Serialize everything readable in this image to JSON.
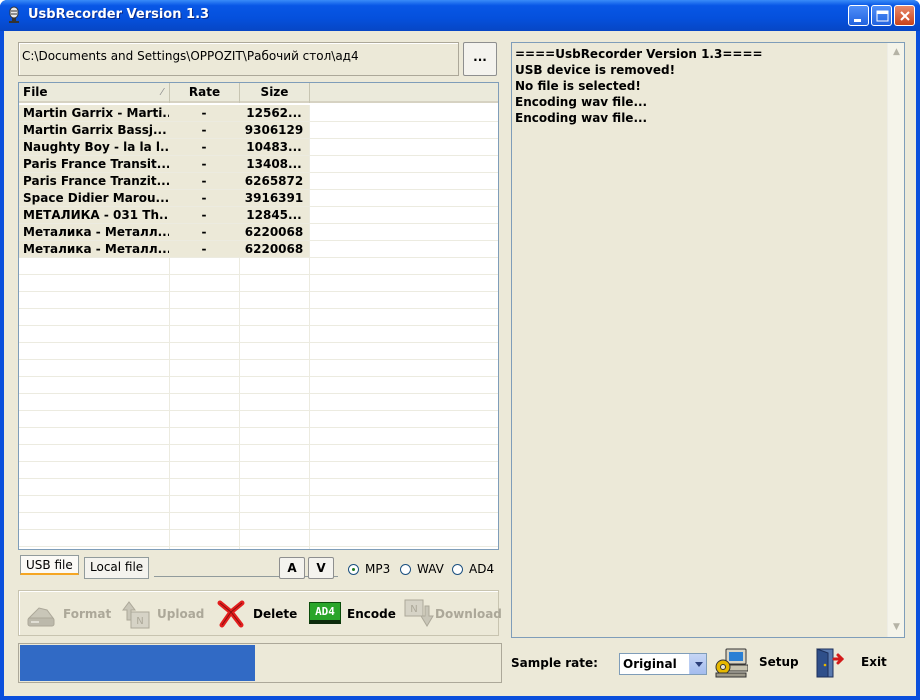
{
  "window": {
    "title": "UsbRecorder Version 1.3"
  },
  "path": {
    "value": "C:\\Documents and Settings\\OPPOZIT\\Рабочий стол\\ад4",
    "browse_label": "..."
  },
  "table": {
    "columns": [
      "File",
      "Rate",
      "Size"
    ],
    "rows": [
      {
        "file": "Martin Garrix - Marti...",
        "rate": "-",
        "size": "12562..."
      },
      {
        "file": "Martin Garrix Bassj...",
        "rate": "-",
        "size": "9306129"
      },
      {
        "file": "Naughty Boy - la la l...",
        "rate": "-",
        "size": "10483..."
      },
      {
        "file": "Paris France Transit...",
        "rate": "-",
        "size": "13408..."
      },
      {
        "file": "Paris France Tranzit...",
        "rate": "-",
        "size": "6265872"
      },
      {
        "file": "Space Didier Marou...",
        "rate": "-",
        "size": "3916391"
      },
      {
        "file": "МЕТАЛИКА - 031 Th...",
        "rate": "-",
        "size": "12845..."
      },
      {
        "file": "Металика - Металл...",
        "rate": "-",
        "size": "6220068"
      },
      {
        "file": "Металика - Металл...",
        "rate": "-",
        "size": "6220068"
      }
    ]
  },
  "tabs": {
    "usb": "USB file",
    "local": "Local file"
  },
  "order_buttons": {
    "up": "A",
    "down": "V"
  },
  "format": {
    "options": [
      "MP3",
      "WAV",
      "AD4"
    ],
    "selected": "MP3"
  },
  "toolbar": {
    "format": "Format",
    "upload": "Upload",
    "delete": "Delete",
    "encode": "Encode",
    "download": "Download",
    "encode_icon_text": "AD4"
  },
  "progress": {
    "value": 0.49
  },
  "log": {
    "lines": [
      "====UsbRecorder Version 1.3====",
      "USB device is removed!",
      "No file is selected!",
      "Encoding wav file...",
      "Encoding wav file..."
    ]
  },
  "sample_rate": {
    "label": "Sample rate:",
    "value": "Original"
  },
  "actions": {
    "setup": "Setup",
    "exit": "Exit"
  },
  "colors": {
    "title_bar": "#0550dc",
    "progress": "#316ac5",
    "face": "#ece9d8"
  }
}
